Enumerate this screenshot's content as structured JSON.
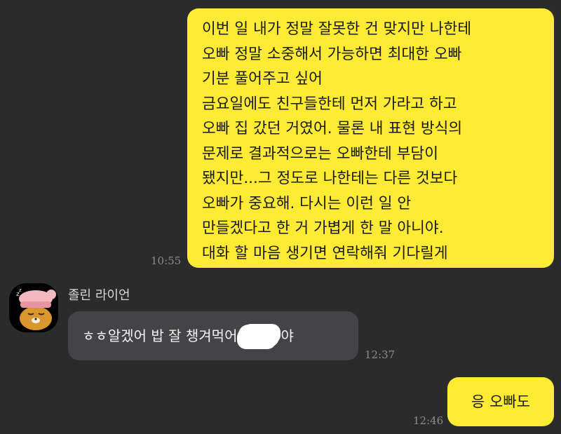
{
  "messages": {
    "sent_long": {
      "lines": [
        "이번 일 내가 정말 잘못한 건 맞지만 나한테",
        "오빠 정말 소중해서 가능하면 최대한 오빠",
        "기분 풀어주고 싶어",
        "금요일에도 친구들한테 먼저 가라고 하고",
        "오빠 집 갔던 거였어. 물론 내 표현 방식의",
        "문제로 결과적으로는 오빠한테 부담이",
        "됐지만...그 정도로 나한테는 다른 것보다",
        "오빠가 중요해. 다시는 이런 일 안",
        "만들겠다고 한 거 가볍게 한 말 아니야.",
        "대화 할 마음 생기면 연락해줘 기다릴게"
      ],
      "time": "10:55"
    },
    "received": {
      "sender_name": "졸린 라이언",
      "text_before": "ㅎㅎ알겠어 밥 잘 챙겨먹어",
      "text_after": "야",
      "time": "12:37",
      "avatar_icon": "sleepy-ryan-avatar-icon"
    },
    "sent_short": {
      "text": "응 오빠도",
      "time": "12:46"
    }
  },
  "colors": {
    "background": "#2b2b2c",
    "sent_bubble": "#ffeb34",
    "received_bubble": "#444446",
    "timestamp": "#8b8b8b"
  }
}
